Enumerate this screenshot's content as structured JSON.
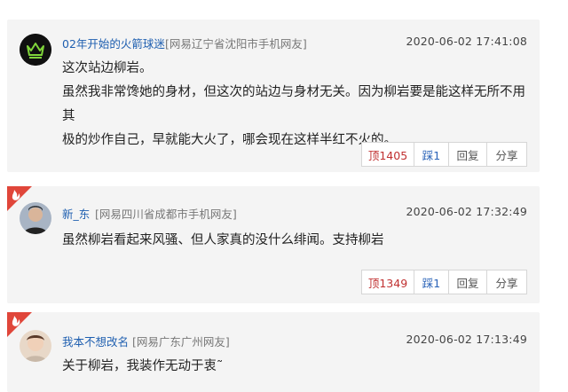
{
  "comments": [
    {
      "username": "02年开始的火箭球迷",
      "location": "[网易辽宁省沈阳市手机网友]",
      "time": "2020-06-02 17:41:08",
      "lines": [
        "这次站边柳岩。",
        "虽然我非常馋她的身材，但这次的站边与身材无关。因为柳岩要是能这样无所不用其",
        "极的炒作自己，早就能大火了，哪会现在这样半红不火的。"
      ],
      "upvote": "顶1405",
      "downvote": "踩1",
      "reply": "回复",
      "share": "分享",
      "hot_badge": false
    },
    {
      "username": "新_东",
      "location": "[网易四川省成都市手机网友]",
      "time": "2020-06-02 17:32:49",
      "lines": [
        "虽然柳岩看起来风骚、但人家真的没什么绯闻。支持柳岩"
      ],
      "upvote": "顶1349",
      "downvote": "踩1",
      "reply": "回复",
      "share": "分享",
      "hot_badge": true
    },
    {
      "username": "我本不想改名",
      "location": "[网易广东广州网友]",
      "time": "2020-06-02 17:13:49",
      "lines": [
        "关于柳岩，我装作无动于衷˜"
      ],
      "hot_badge": true
    }
  ],
  "colors": {
    "username": "#1f5fb0",
    "upvote": "#c03030",
    "downvote": "#2a63b8",
    "hot_badge": "#e0463a",
    "card_bg": "#f4f4f4"
  },
  "icons": [
    "hot-flame-icon",
    "crown-avatar-icon",
    "user-avatar-photo"
  ]
}
